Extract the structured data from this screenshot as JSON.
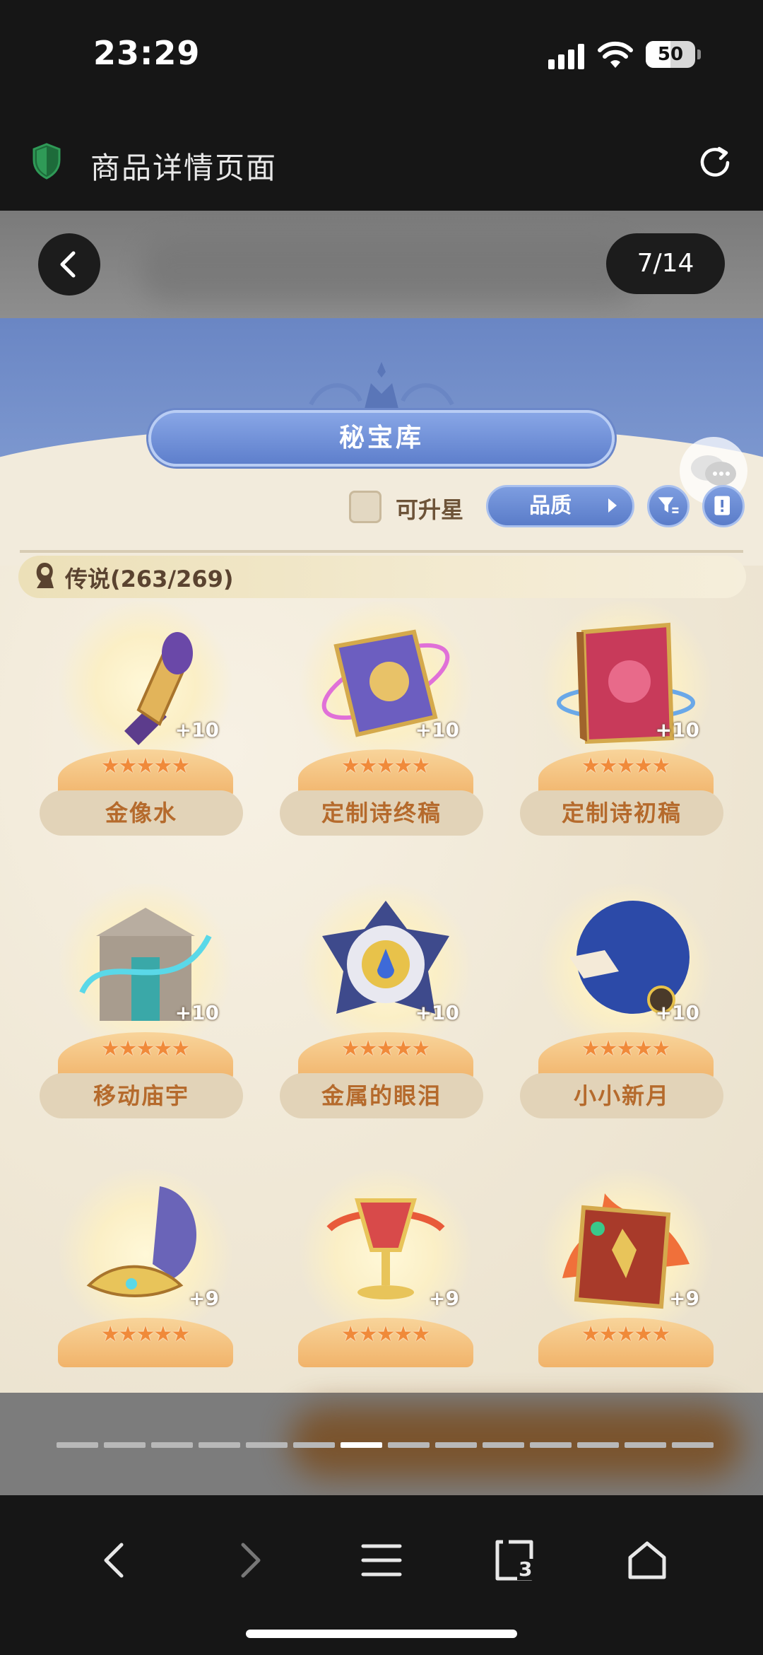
{
  "status_bar": {
    "time": "23:29",
    "battery": "50"
  },
  "browser": {
    "title": "商品详情页面",
    "tab_count": "3"
  },
  "viewer": {
    "counter": "7/14",
    "total_pages": 14,
    "current_page": 7
  },
  "game": {
    "title": "秘宝库",
    "upgradable_label": "可升星",
    "quality_label": "品质",
    "category": "传说(263/269)",
    "items": [
      {
        "name": "金像水",
        "plus": "+10",
        "stars": 5
      },
      {
        "name": "定制诗终稿",
        "plus": "+10",
        "stars": 5
      },
      {
        "name": "定制诗初稿",
        "plus": "+10",
        "stars": 5
      },
      {
        "name": "移动庙宇",
        "plus": "+10",
        "stars": 5
      },
      {
        "name": "金属的眼泪",
        "plus": "+10",
        "stars": 5
      },
      {
        "name": "小小新月",
        "plus": "+10",
        "stars": 5
      },
      {
        "name": "",
        "plus": "+9",
        "stars": 5
      },
      {
        "name": "",
        "plus": "+9",
        "stars": 5
      },
      {
        "name": "",
        "plus": "+9",
        "stars": 5
      }
    ]
  },
  "colors": {
    "banner": "#6a86c4",
    "accent_blue": "#5a7cc9",
    "item_name": "#b56a2c",
    "star": "#f08a3a"
  }
}
